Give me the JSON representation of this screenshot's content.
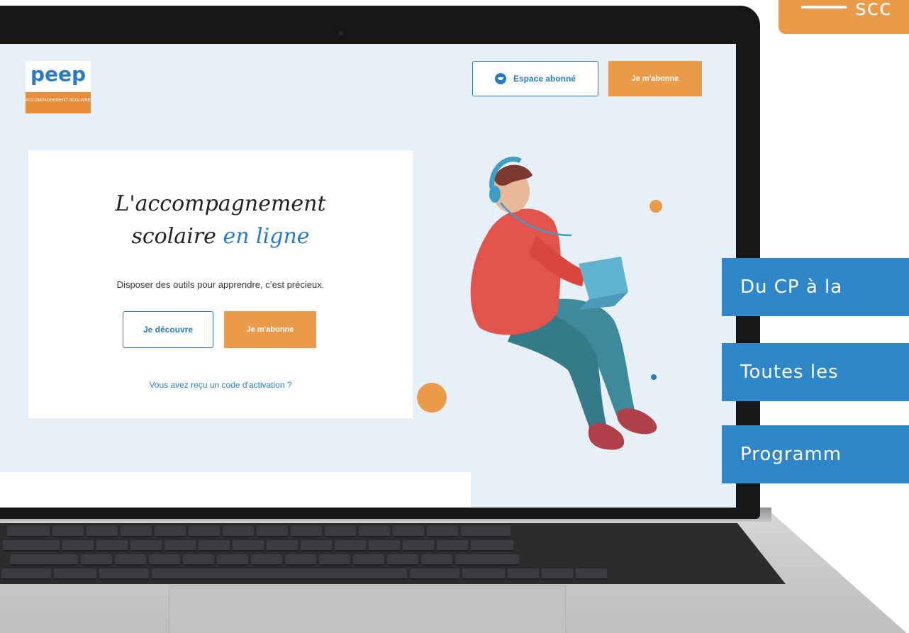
{
  "corner_tab": {
    "text": "scc"
  },
  "logo": {
    "brand": "peep",
    "subtitle": "ACCOMPAGNEMENT SCOLAIRE"
  },
  "header": {
    "espace_label": "Espace abonné",
    "subscribe_label": "Je m'abonne"
  },
  "hero": {
    "title_line1": "L'accompagnement",
    "title_line2_plain": "scolaire",
    "title_line2_accent": "en ligne",
    "tagline": "Disposer des outils pour apprendre, c’est précieux.",
    "discover_label": "Je découvre",
    "subscribe_label": "Je m'abonne",
    "activation_link": "Vous avez reçu un code d'activation ?"
  },
  "banners": [
    {
      "text": "Du CP à la"
    },
    {
      "text": "Toutes les"
    },
    {
      "text": "Programm"
    }
  ],
  "colors": {
    "orange": "#ea9a49",
    "blue": "#2a7cc2",
    "banner_blue": "#2f86c8",
    "screen_bg": "#e7f0f6"
  },
  "icons": {
    "espace": "user-face-icon"
  }
}
